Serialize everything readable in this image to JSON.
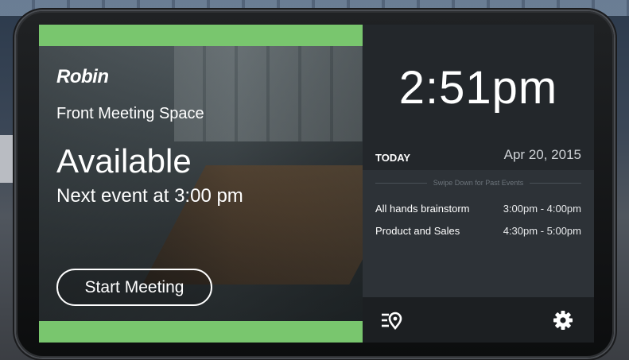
{
  "left_panel": {
    "brand": "Robin",
    "room_name": "Front Meeting Space",
    "status": "Available",
    "next_event": "Next event at 3:00 pm",
    "start_button_label": "Start Meeting",
    "accent_color": "#79c66e"
  },
  "right_panel": {
    "clock": "2:51pm",
    "today_label": "TODAY",
    "date": "Apr 20, 2015",
    "swipe_hint": "Swipe Down for Past Events",
    "events": [
      {
        "name": "All hands brainstorm",
        "time": "3:00pm - 4:00pm"
      },
      {
        "name": "Product and Sales",
        "time": "4:30pm - 5:00pm"
      }
    ],
    "bottom_icons": [
      "find-room-icon",
      "gear-icon"
    ]
  }
}
